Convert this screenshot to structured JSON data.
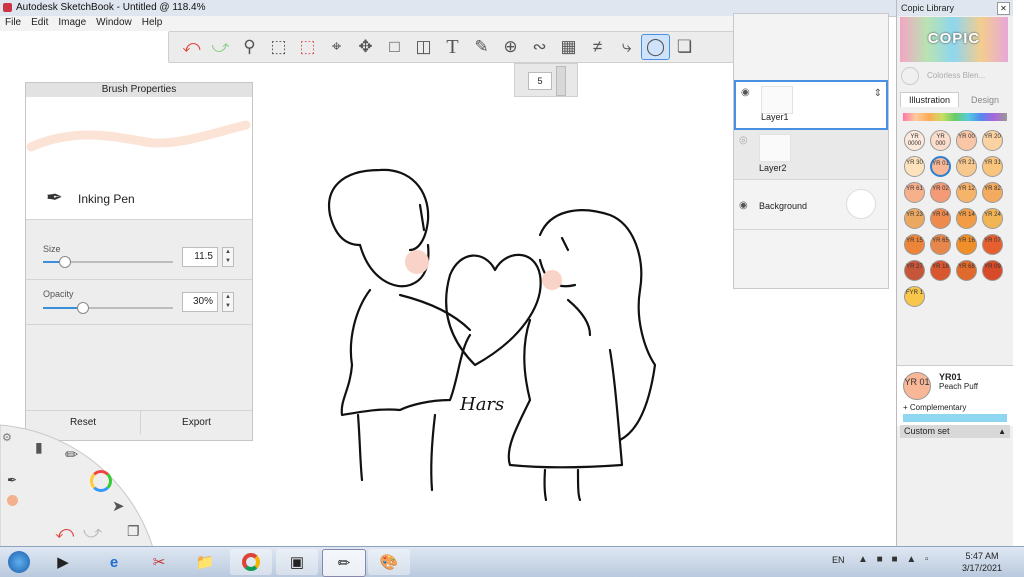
{
  "window": {
    "title": "Autodesk SketchBook - Untitled @ 118.4%"
  },
  "menu": [
    "File",
    "Edit",
    "Image",
    "Window",
    "Help"
  ],
  "toolbar": {
    "tools": [
      "undo-icon",
      "redo-icon",
      "zoom-icon",
      "rect-select-icon",
      "lasso-select-icon",
      "crop-icon",
      "transform-icon",
      "distort-icon",
      "fill-icon",
      "text-icon",
      "ruler-icon",
      "ellipse-guide-icon",
      "french-curve-icon",
      "perspective-icon",
      "symmetry-icon",
      "stroke-icon",
      "ellipse-icon",
      "shapes-icon"
    ],
    "active_tool": "ellipse-icon",
    "tools_right": [
      "layers-icon",
      "brushes-icon",
      "color-wheel-icon",
      "palettes-icon"
    ]
  },
  "brush_size_popup": {
    "value": "5"
  },
  "brush_properties": {
    "title": "Brush Properties",
    "brush_name": "Inking Pen",
    "size_label": "Size",
    "size_value": "11.5",
    "size_fraction": 0.16,
    "opacity_label": "Opacity",
    "opacity_value": "30%",
    "opacity_fraction": 0.3,
    "reset_label": "Reset",
    "export_label": "Export"
  },
  "layers": {
    "items": [
      {
        "name": "Layer1",
        "visible": true,
        "selected": true
      },
      {
        "name": "Layer2",
        "visible": false,
        "selected": false
      },
      {
        "name": "Background",
        "visible": true,
        "selected": false
      }
    ]
  },
  "canvas": {
    "signature_text": "Hars"
  },
  "copic": {
    "title": "Copic Library",
    "logo": "COPIC",
    "colorless": "Colorless Blen...",
    "tab_illustration": "Illustration",
    "tab_design": "Design",
    "swatches": [
      {
        "code": "YR 0000",
        "color": "#fde9dc"
      },
      {
        "code": "YR 000",
        "color": "#fcdccb"
      },
      {
        "code": "YR 00",
        "color": "#f9c6a8"
      },
      {
        "code": "YR 20",
        "color": "#fbd3a3"
      },
      {
        "code": "YR 30",
        "color": "#fde2bc"
      },
      {
        "code": "YR 01",
        "color": "#f8b796"
      },
      {
        "code": "YR 21",
        "color": "#f7c98f"
      },
      {
        "code": "YR 31",
        "color": "#f9c57d"
      },
      {
        "code": "YR 61",
        "color": "#f7b08c"
      },
      {
        "code": "YR 02",
        "color": "#f49a76"
      },
      {
        "code": "YR 12",
        "color": "#f6b36a"
      },
      {
        "code": "YR 82",
        "color": "#f4aa5f"
      },
      {
        "code": "YR 23",
        "color": "#eba860"
      },
      {
        "code": "YR 04",
        "color": "#ef8a4e"
      },
      {
        "code": "YR 14",
        "color": "#f29d45"
      },
      {
        "code": "YR 24",
        "color": "#f1b556"
      },
      {
        "code": "YR 15",
        "color": "#ec8539"
      },
      {
        "code": "YR 65",
        "color": "#e7874b"
      },
      {
        "code": "YR 16",
        "color": "#f08f2a"
      },
      {
        "code": "YR 07",
        "color": "#e5602e"
      },
      {
        "code": "YR 27",
        "color": "#c7553a"
      },
      {
        "code": "YR 18",
        "color": "#d8572e"
      },
      {
        "code": "YR 68",
        "color": "#e06a2b"
      },
      {
        "code": "YR 09",
        "color": "#d84b2a"
      },
      {
        "code": "FYR 1",
        "color": "#f7c64a"
      }
    ],
    "selected_code": "YR 01",
    "selected_name": "YR01",
    "selected_desc": "Peach Puff",
    "complementary": "+ Complementary",
    "custom_set": "Custom set"
  },
  "taskbar": {
    "language": "EN",
    "time": "5:47 AM",
    "date": "3/17/2021",
    "apps": [
      "start-orb-icon",
      "media-player-icon",
      "ie-icon",
      "snipping-icon",
      "explorer-icon",
      "chrome-icon",
      "photos-icon",
      "sketchbook-icon",
      "paint-icon"
    ]
  }
}
